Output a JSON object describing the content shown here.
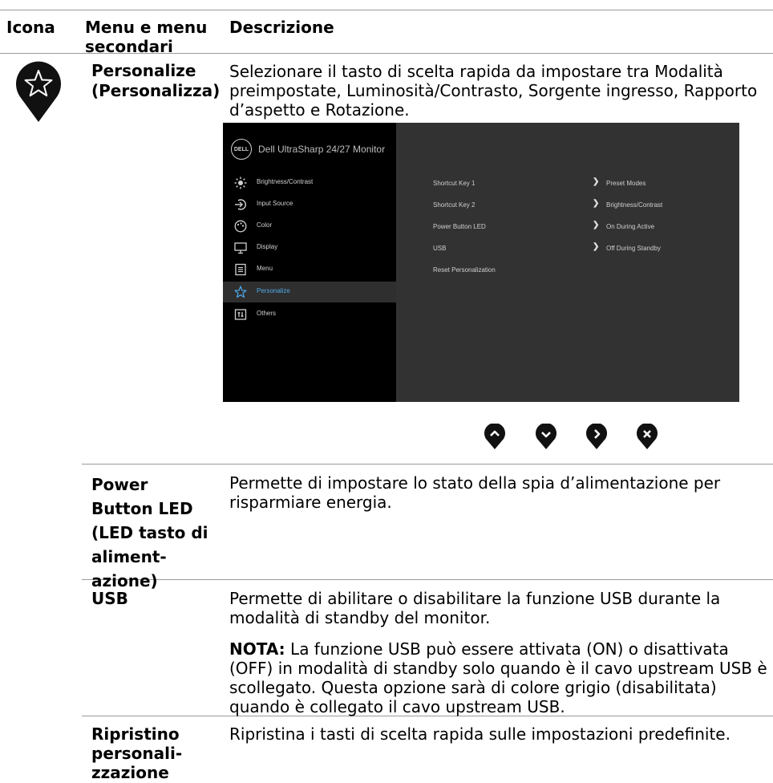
{
  "header": {
    "col_icon": "Icona",
    "col_menu": "Menu e menu secondari",
    "col_desc": "Descrizione"
  },
  "personalize": {
    "label": "Personalize (Personalizza)",
    "description": "Selezionare il tasto di scelta rapida da impostare tra Modalità preimpostate, Luminosità/Contrasto, Sorgente ingresso, Rapporto d’aspetto e Rotazione.",
    "icon": "star-pin-icon"
  },
  "osd": {
    "logo": "DELL",
    "title": "Dell UltraSharp 24/27 Monitor",
    "menu": [
      {
        "label": "Brightness/Contrast",
        "icon": "sun-icon"
      },
      {
        "label": "Input Source",
        "icon": "input-icon"
      },
      {
        "label": "Color",
        "icon": "palette-icon"
      },
      {
        "label": "Display",
        "icon": "display-icon"
      },
      {
        "label": "Menu",
        "icon": "menu-icon"
      },
      {
        "label": "Personalize",
        "icon": "star-icon",
        "selected": true
      },
      {
        "label": "Others",
        "icon": "others-icon"
      }
    ],
    "rows": [
      {
        "setting": "Shortcut Key 1",
        "value": "Preset Modes"
      },
      {
        "setting": "Shortcut Key 2",
        "value": "Brightness/Contrast"
      },
      {
        "setting": "Power Button LED",
        "value": "On During Active"
      },
      {
        "setting": "USB",
        "value": "Off During Standby"
      },
      {
        "setting": "Reset Personalization",
        "value": ""
      }
    ],
    "buttons": [
      "up-button-icon",
      "down-button-icon",
      "right-button-icon",
      "close-button-icon"
    ],
    "accent": "#4fa9ea"
  },
  "power_led": {
    "label": "Power\nButton LED\n(LED tasto di\naliment-\nazione)",
    "description": "Permette di impostare lo stato della spia d’alimentazione per risparmiare energia."
  },
  "usb": {
    "label": "USB",
    "description": "Permette di abilitare o disabilitare la funzione USB durante la modalità di standby del monitor.",
    "note_label": "NOTA:",
    "note_text": " La funzione USB può essere attivata (ON) o disattivata (OFF) in modalità di standby solo quando è il cavo upstream USB è scollegato. Questa opzione sarà di colore grigio (disabilitata) quando è collegato il cavo upstream USB."
  },
  "reset": {
    "label": "Ripristino\npersonali-\nzzazione",
    "description": "Ripristina i tasti di scelta rapida sulle impostazioni predefinite."
  }
}
